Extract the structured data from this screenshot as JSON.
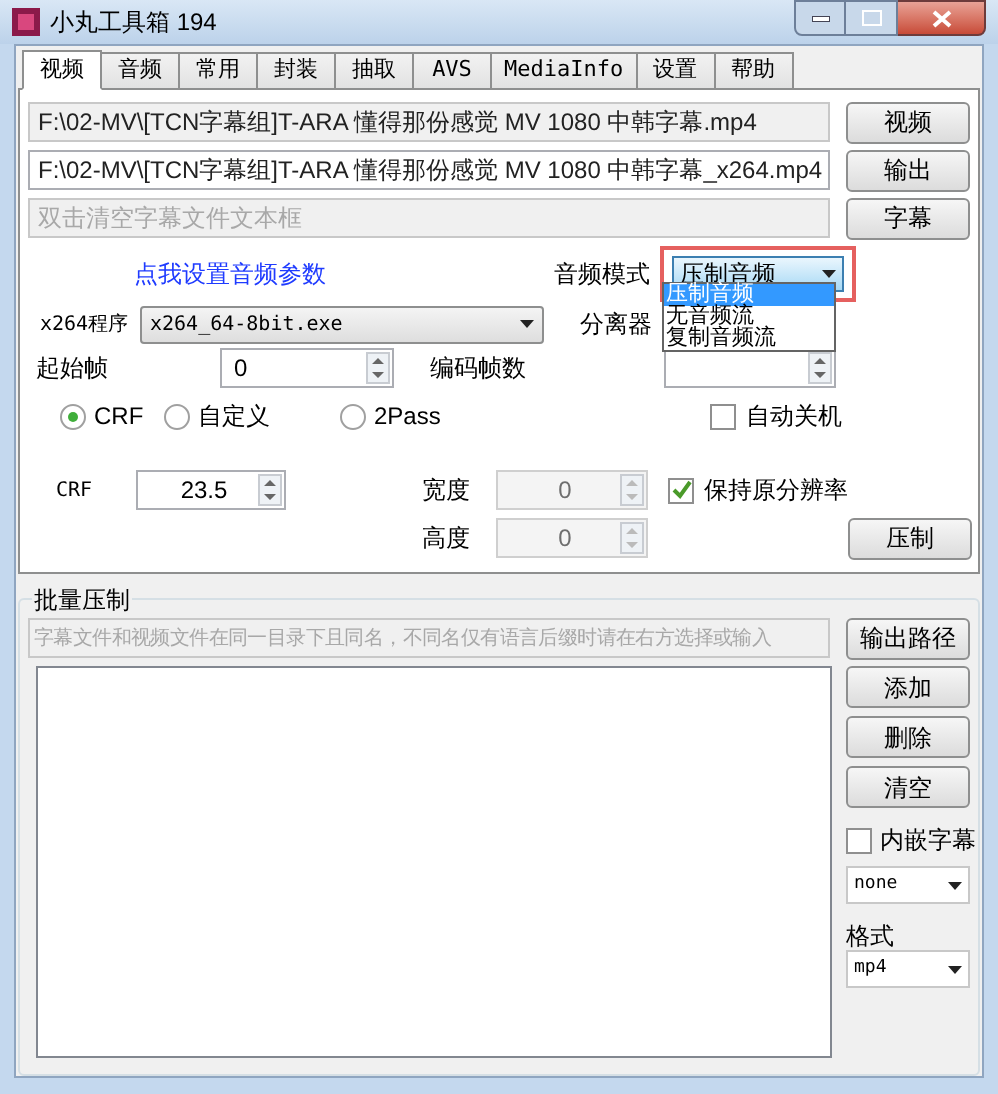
{
  "window": {
    "title": "小丸工具箱 194"
  },
  "tabs": [
    {
      "label": "视频",
      "selected": true
    },
    {
      "label": "音频",
      "selected": false
    },
    {
      "label": "常用",
      "selected": false
    },
    {
      "label": "封装",
      "selected": false
    },
    {
      "label": "抽取",
      "selected": false
    },
    {
      "label": "AVS",
      "selected": false
    },
    {
      "label": "MediaInfo",
      "selected": false
    },
    {
      "label": "设置",
      "selected": false
    },
    {
      "label": "帮助",
      "selected": false
    }
  ],
  "files": [
    {
      "value": "F:\\02-MV\\[TCN字幕组]T-ARA 懂得那份感觉 MV 1080 中韩字幕.mp4",
      "readonly": true,
      "button": "视频"
    },
    {
      "value": "F:\\02-MV\\[TCN字幕组]T-ARA 懂得那份感觉 MV 1080 中韩字幕_x264.mp4",
      "readonly": false,
      "button": "输出"
    },
    {
      "placeholder": "双击清空字幕文件文本框",
      "readonly": true,
      "button": "字幕"
    }
  ],
  "audio_link": "点我设置音频参数",
  "audio_mode": {
    "label": "音频模式",
    "value": "压制音频",
    "expanded": true,
    "options": [
      {
        "label": "压制音频",
        "selected": true
      },
      {
        "label": "无音频流",
        "selected": false
      },
      {
        "label": "复制音频流",
        "selected": false
      }
    ]
  },
  "x264": {
    "label": "x264程序",
    "value": "x264_64-8bit.exe"
  },
  "demuxer": {
    "label": "分离器"
  },
  "start_frame": {
    "label": "起始帧",
    "value": "0"
  },
  "frame_count": {
    "label": "编码帧数"
  },
  "rate_modes": [
    {
      "label": "CRF",
      "selected": true
    },
    {
      "label": "自定义",
      "selected": false
    },
    {
      "label": "2Pass",
      "selected": false
    }
  ],
  "auto_shutdown": {
    "label": "自动关机",
    "checked": false
  },
  "crf": {
    "label": "CRF",
    "value": "23.5"
  },
  "width": {
    "label": "宽度",
    "value": "0",
    "disabled": true
  },
  "height": {
    "label": "高度",
    "value": "0",
    "disabled": true
  },
  "keep_resolution": {
    "label": "保持原分辨率",
    "checked": true
  },
  "encode_button": "压制",
  "batch": {
    "title": "批量压制",
    "placeholder": "字幕文件和视频文件在同一目录下且同名，不同名仅有语言后缀时请在右方选择或输入",
    "buttons": [
      "输出路径",
      "添加",
      "删除",
      "清空"
    ],
    "embed_subtitles": {
      "label": "内嵌字幕",
      "checked": false
    },
    "subtitle_lang": "none",
    "format_label": "格式",
    "format": "mp4"
  }
}
